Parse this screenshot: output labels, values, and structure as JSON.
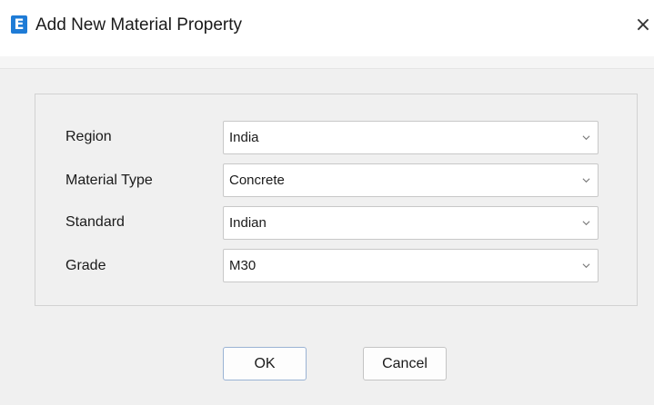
{
  "window": {
    "app_icon_letter": "E",
    "title": "Add New Material Property",
    "close_glyph": "×",
    "accent_color": "#1e7bd6"
  },
  "form": {
    "fields": [
      {
        "label": "Region",
        "value": "India"
      },
      {
        "label": "Material Type",
        "value": "Concrete"
      },
      {
        "label": "Standard",
        "value": "Indian"
      },
      {
        "label": "Grade",
        "value": "M30"
      }
    ]
  },
  "buttons": {
    "ok_label": "OK",
    "cancel_label": "Cancel"
  },
  "icons": {
    "dropdown": "chevron-down-icon",
    "close": "close-icon",
    "app": "app-logo-icon"
  }
}
